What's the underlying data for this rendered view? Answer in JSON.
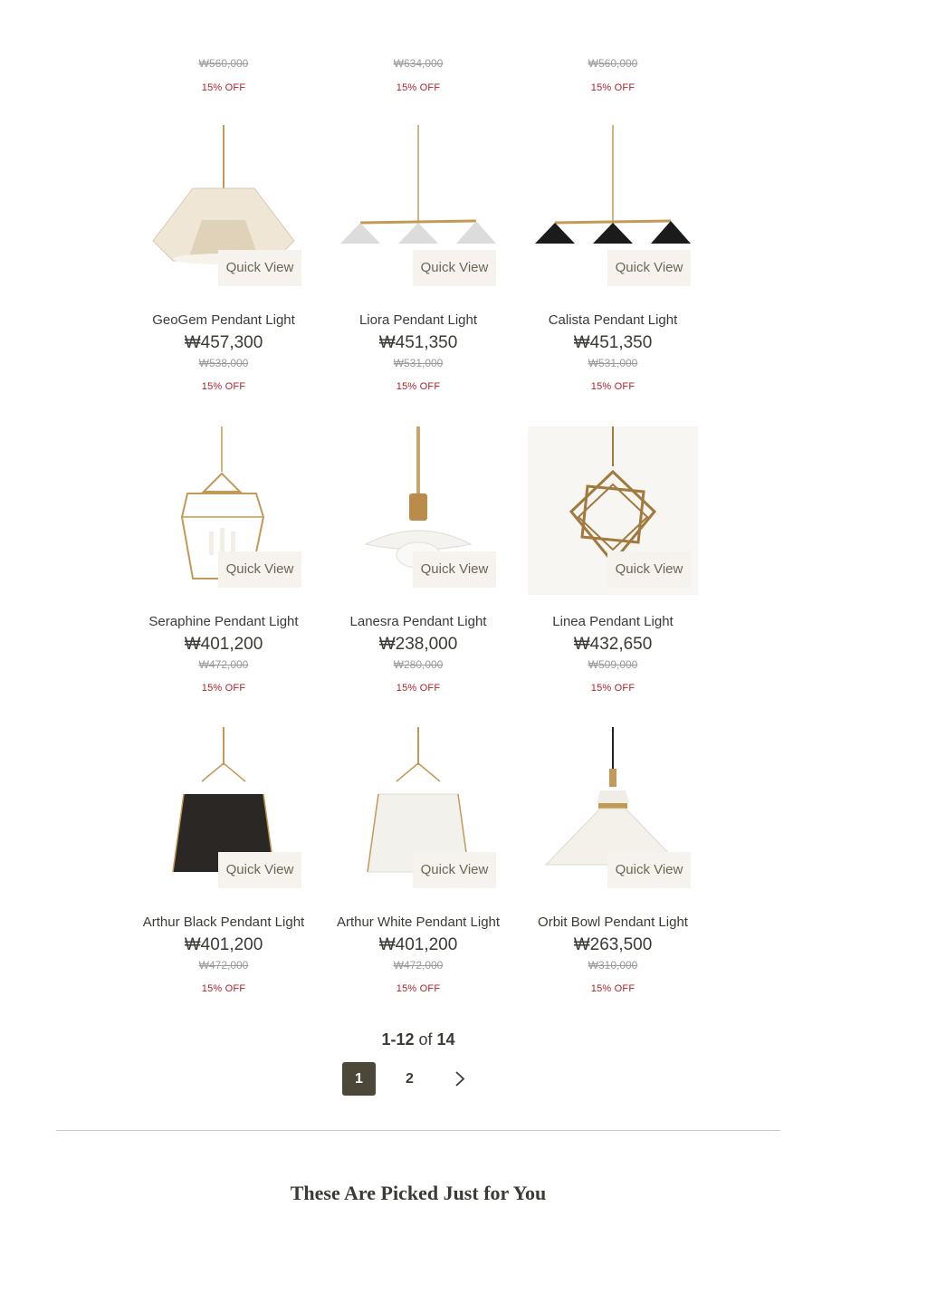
{
  "partial_row": [
    {
      "original_price": "₩560,000",
      "discount": "15% OFF"
    },
    {
      "original_price": "₩634,000",
      "discount": "15% OFF"
    },
    {
      "original_price": "₩560,000",
      "discount": "15% OFF"
    }
  ],
  "quick_view_label": "Quick View",
  "products": [
    {
      "name": "GeoGem Pendant Light",
      "price": "₩457,300",
      "original_price": "₩538,000",
      "discount": "15% OFF"
    },
    {
      "name": "Liora Pendant Light",
      "price": "₩451,350",
      "original_price": "₩531,000",
      "discount": "15% OFF"
    },
    {
      "name": "Calista Pendant Light",
      "price": "₩451,350",
      "original_price": "₩531,000",
      "discount": "15% OFF"
    },
    {
      "name": "Seraphine Pendant Light",
      "price": "₩401,200",
      "original_price": "₩472,000",
      "discount": "15% OFF"
    },
    {
      "name": "Lanesra Pendant Light",
      "price": "₩238,000",
      "original_price": "₩280,000",
      "discount": "15% OFF"
    },
    {
      "name": "Linea Pendant Light",
      "price": "₩432,650",
      "original_price": "₩509,000",
      "discount": "15% OFF"
    },
    {
      "name": "Arthur Black Pendant Light",
      "price": "₩401,200",
      "original_price": "₩472,000",
      "discount": "15% OFF"
    },
    {
      "name": "Arthur White Pendant Light",
      "price": "₩401,200",
      "original_price": "₩472,000",
      "discount": "15% OFF"
    },
    {
      "name": "Orbit Bowl Pendant Light",
      "price": "₩263,500",
      "original_price": "₩310,000",
      "discount": "15% OFF"
    }
  ],
  "pagination": {
    "range": "1-12",
    "of_word": "of",
    "total": "14",
    "pages": [
      "1",
      "2"
    ],
    "current": "1",
    "next_icon": "chevron-right-icon"
  },
  "recommendations": {
    "title": "These Are Picked Just for You"
  },
  "colors": {
    "accent_dark": "#4c4839",
    "discount_red": "#b0232a",
    "quick_view_bg": "#f6f3ee",
    "brass": "#c29a55"
  }
}
